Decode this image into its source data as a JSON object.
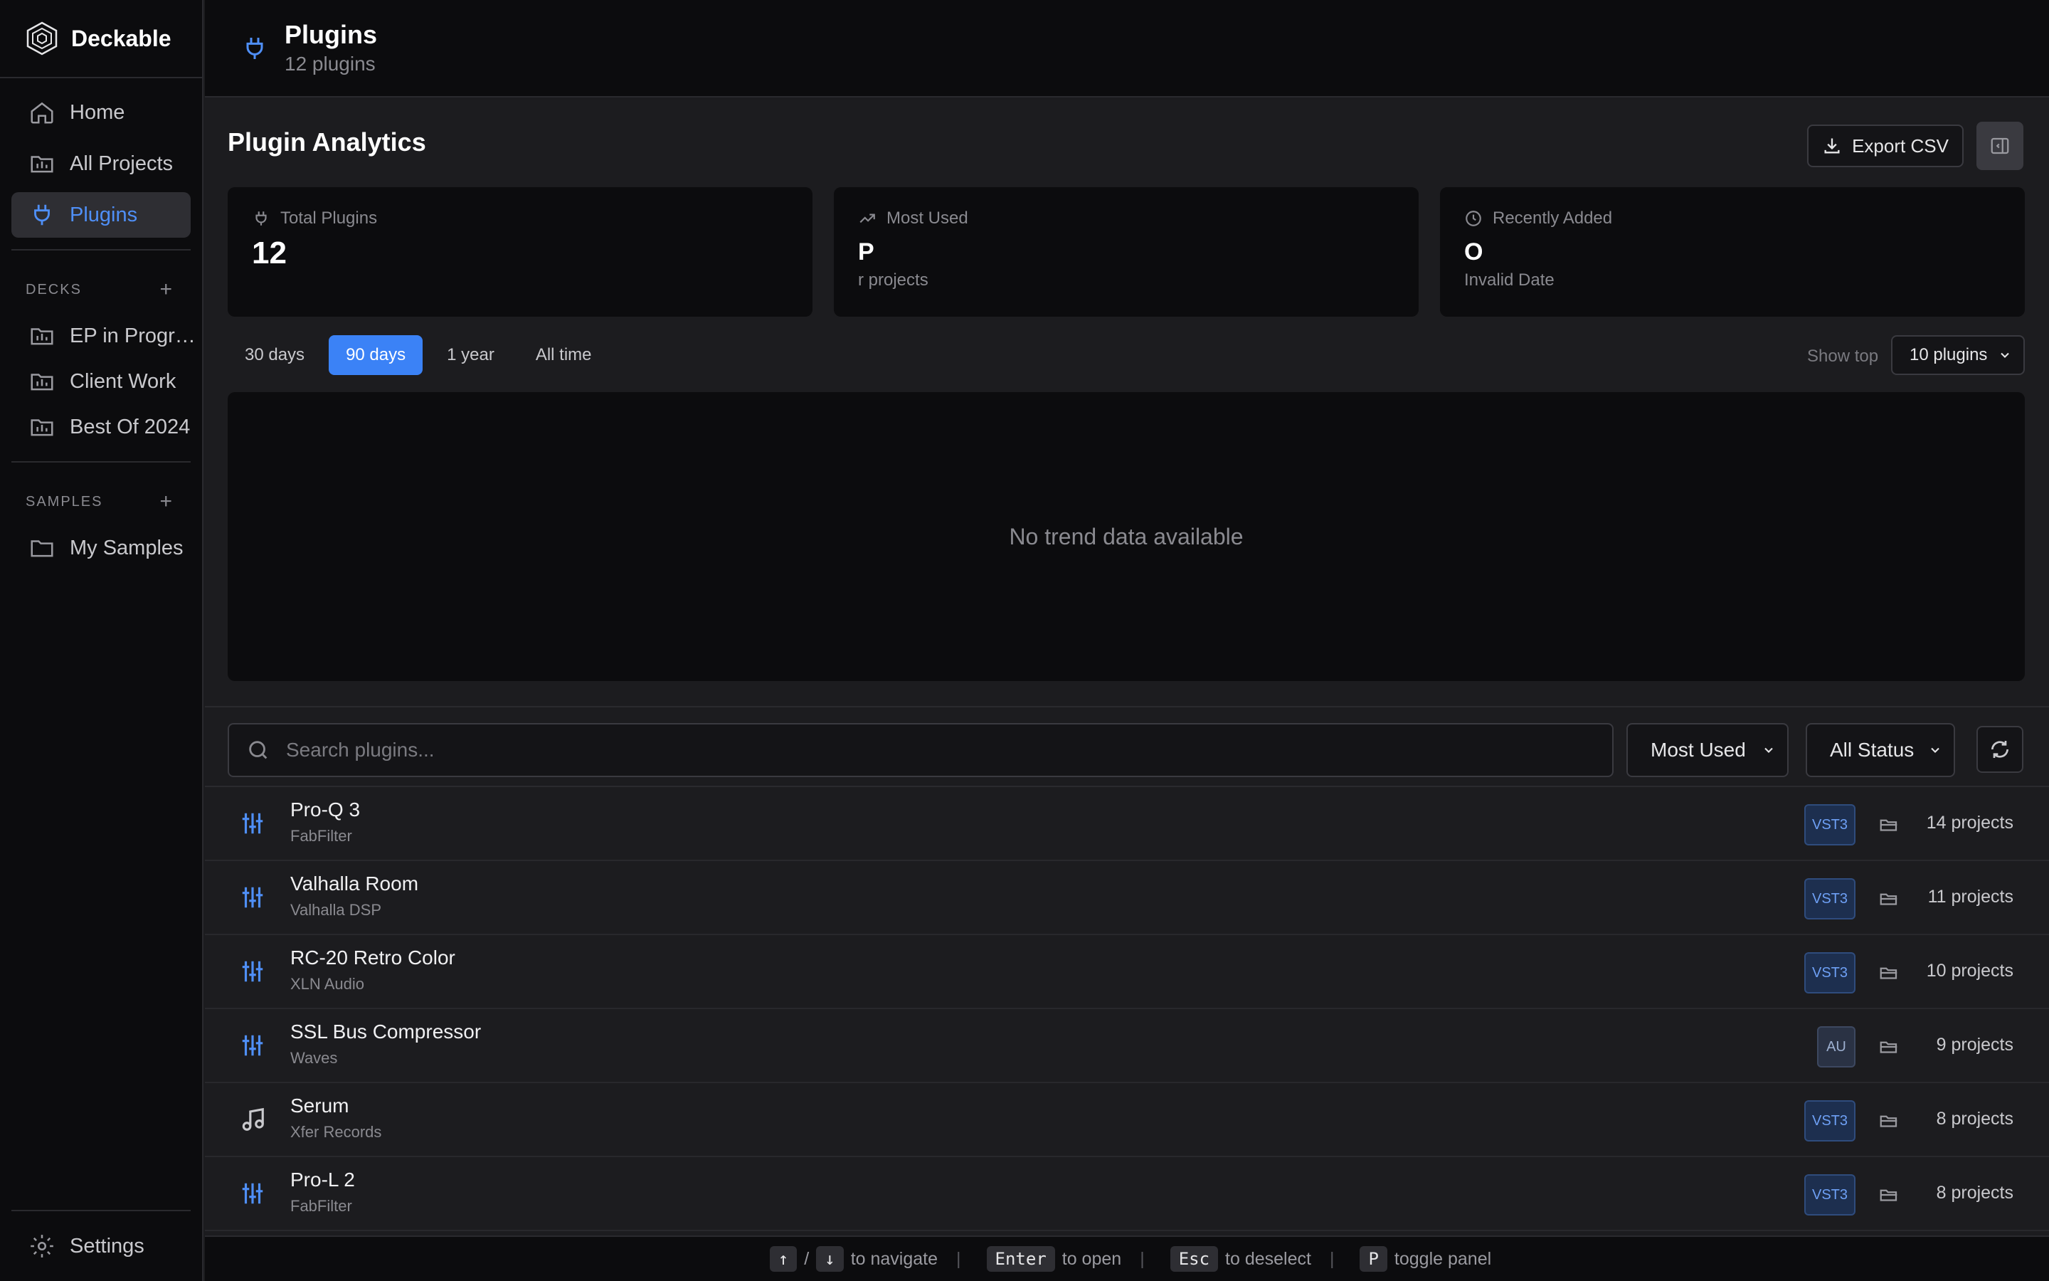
{
  "app": {
    "name": "Deckable"
  },
  "nav": {
    "home": "Home",
    "all_projects": "All Projects",
    "plugins": "Plugins"
  },
  "decks": {
    "heading": "DECKS",
    "items": [
      "EP in Progress",
      "Client Work",
      "Best Of 2024"
    ]
  },
  "samples": {
    "heading": "SAMPLES",
    "items": [
      "My Samples"
    ]
  },
  "settings_label": "Settings",
  "header": {
    "title": "Plugins",
    "subtitle": "12 plugins"
  },
  "analytics": {
    "title": "Plugin Analytics",
    "export_label": "Export CSV",
    "stats": [
      {
        "label": "Total Plugins",
        "value": "12",
        "sub": ""
      },
      {
        "label": "Most Used",
        "value": "P",
        "sub": "r projects"
      },
      {
        "label": "Recently Added",
        "value": "O",
        "sub": "Invalid Date"
      }
    ],
    "ranges": [
      "30 days",
      "90 days",
      "1 year",
      "All time"
    ],
    "active_range": "90 days",
    "show_top_label": "Show top",
    "show_top_value": "10 plugins",
    "empty_message": "No trend data available"
  },
  "filters": {
    "search_placeholder": "Search plugins...",
    "sort": "Most Used",
    "status": "All Status"
  },
  "plugins": [
    {
      "name": "Pro-Q 3",
      "vendor": "FabFilter",
      "format": "VST3",
      "count": "14 projects",
      "icon": "sliders-icon"
    },
    {
      "name": "Valhalla Room",
      "vendor": "Valhalla DSP",
      "format": "VST3",
      "count": "11 projects",
      "icon": "sliders-icon"
    },
    {
      "name": "RC-20 Retro Color",
      "vendor": "XLN Audio",
      "format": "VST3",
      "count": "10 projects",
      "icon": "sliders-icon"
    },
    {
      "name": "SSL Bus Compressor",
      "vendor": "Waves",
      "format": "AU",
      "count": "9 projects",
      "icon": "sliders-icon"
    },
    {
      "name": "Serum",
      "vendor": "Xfer Records",
      "format": "VST3",
      "count": "8 projects",
      "icon": "music-note-icon"
    },
    {
      "name": "Pro-L 2",
      "vendor": "FabFilter",
      "format": "VST3",
      "count": "8 projects",
      "icon": "sliders-icon"
    }
  ],
  "shortcuts": {
    "up": "↑",
    "slash": "/",
    "down": "↓",
    "navigate": "to navigate",
    "enter": "Enter",
    "open": "to open",
    "esc": "Esc",
    "deselect": "to deselect",
    "p": "P",
    "toggle": "toggle panel"
  },
  "colors": {
    "accent": "#3b82f6",
    "background": "#1c1c1f",
    "sidebar": "#0c0c0e"
  }
}
